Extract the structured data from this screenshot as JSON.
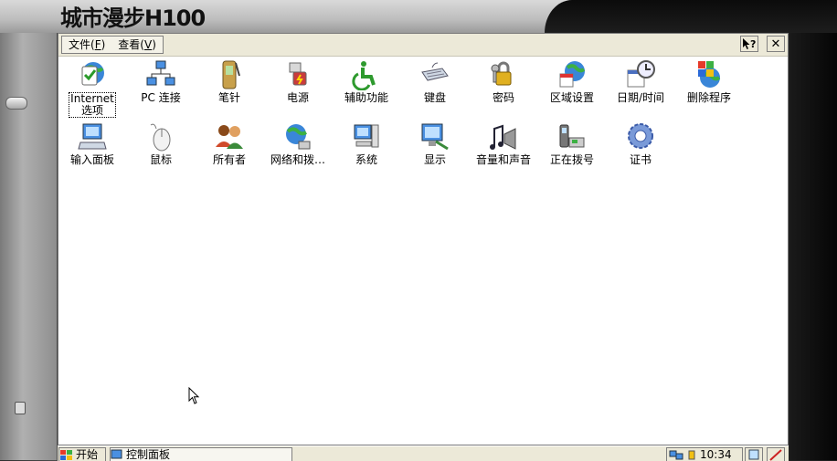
{
  "device": {
    "title": "城市漫步H100"
  },
  "menubar": {
    "menus": [
      {
        "label": "文件(",
        "key": "F",
        "suffix": ")"
      },
      {
        "label": "查看(",
        "key": "V",
        "suffix": ")"
      }
    ],
    "help_icon": "help-question-icon",
    "close_label": "✕"
  },
  "items": [
    {
      "label": "Internet 选项",
      "icon": "internet-options-icon",
      "selected": true
    },
    {
      "label": "PC 连接",
      "icon": "pc-connection-icon"
    },
    {
      "label": "笔针",
      "icon": "stylus-icon"
    },
    {
      "label": "电源",
      "icon": "power-icon"
    },
    {
      "label": "辅助功能",
      "icon": "accessibility-icon"
    },
    {
      "label": "键盘",
      "icon": "keyboard-icon"
    },
    {
      "label": "密码",
      "icon": "password-icon"
    },
    {
      "label": "区域设置",
      "icon": "regional-settings-icon"
    },
    {
      "label": "日期/时间",
      "icon": "date-time-icon"
    },
    {
      "label": "删除程序",
      "icon": "remove-programs-icon"
    },
    {
      "label": "输入面板",
      "icon": "input-panel-icon"
    },
    {
      "label": "鼠标",
      "icon": "mouse-icon"
    },
    {
      "label": "所有者",
      "icon": "owner-icon"
    },
    {
      "label": "网络和拨…",
      "icon": "network-dialup-icon"
    },
    {
      "label": "系统",
      "icon": "system-icon"
    },
    {
      "label": "显示",
      "icon": "display-icon"
    },
    {
      "label": "音量和声音",
      "icon": "volume-sounds-icon"
    },
    {
      "label": "正在拨号",
      "icon": "dialing-icon"
    },
    {
      "label": "证书",
      "icon": "certificates-icon"
    }
  ],
  "taskbar": {
    "start_label": "开始",
    "task_label": "控制面板",
    "clock": "10:34"
  }
}
